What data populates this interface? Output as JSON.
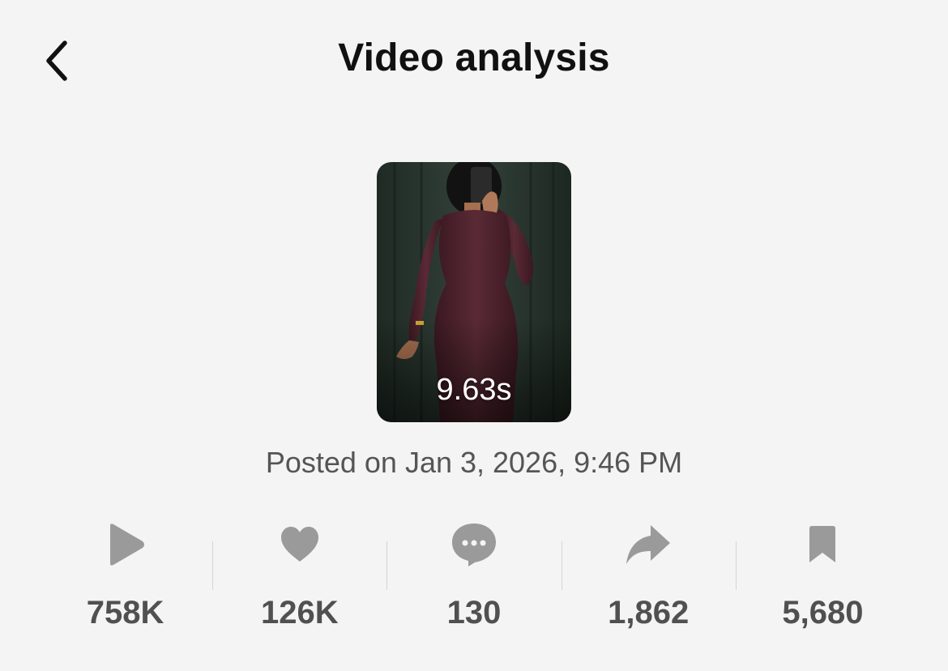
{
  "header": {
    "title": "Video analysis",
    "back_icon": "chevron-left-icon"
  },
  "video": {
    "duration": "9.63s",
    "posted": "Posted on Jan 3, 2026, 9:46 PM"
  },
  "stats": [
    {
      "icon": "play-icon",
      "value": "758K"
    },
    {
      "icon": "heart-icon",
      "value": "126K"
    },
    {
      "icon": "comment-icon",
      "value": "130"
    },
    {
      "icon": "share-icon",
      "value": "1,862"
    },
    {
      "icon": "bookmark-icon",
      "value": "5,680"
    }
  ],
  "colors": {
    "background": "#f4f4f4",
    "icon": "#9a9a9a",
    "value_text": "#505050",
    "title_text": "#111111"
  }
}
